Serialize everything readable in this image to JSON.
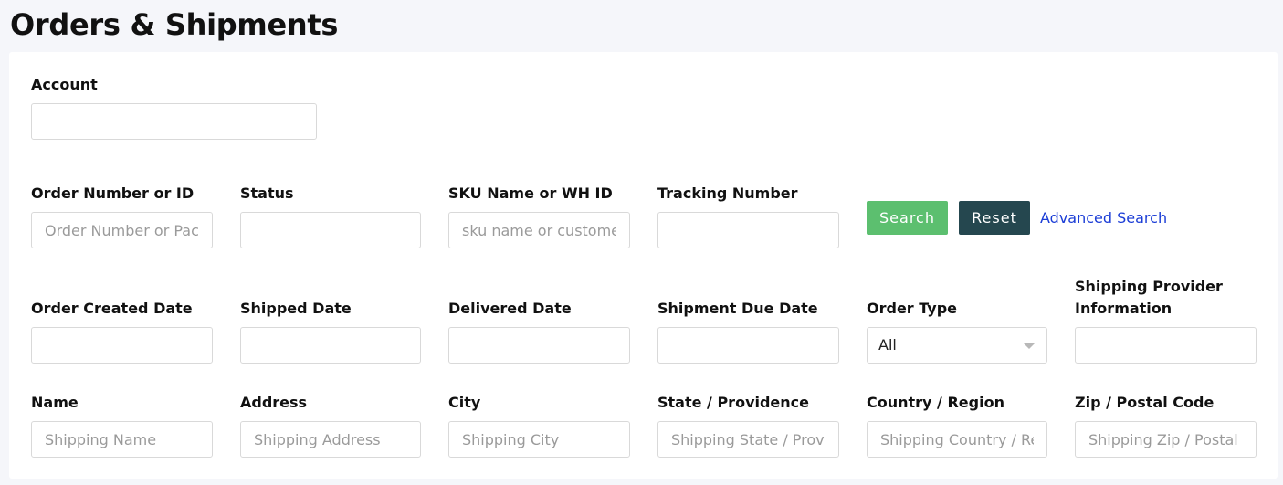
{
  "page": {
    "title": "Orders & Shipments"
  },
  "account": {
    "label": "Account",
    "value": "",
    "placeholder": ""
  },
  "row1": {
    "order_number": {
      "label": "Order Number or ID",
      "placeholder": "Order Number or Package ID"
    },
    "status": {
      "label": "Status",
      "value": ""
    },
    "sku": {
      "label": "SKU Name or WH ID",
      "placeholder": "sku name or customer id"
    },
    "tracking": {
      "label": "Tracking Number",
      "placeholder": ""
    },
    "search_label": "Search",
    "reset_label": "Reset",
    "advanced_label": "Advanced Search"
  },
  "row2": {
    "order_created": {
      "label": "Order Created Date"
    },
    "shipped": {
      "label": "Shipped Date"
    },
    "delivered": {
      "label": "Delivered Date"
    },
    "due": {
      "label": "Shipment Due Date"
    },
    "order_type": {
      "label": "Order Type",
      "value": "All"
    },
    "provider": {
      "label": "Shipping Provider Information"
    }
  },
  "row3": {
    "name": {
      "label": "Name",
      "placeholder": "Shipping Name"
    },
    "address": {
      "label": "Address",
      "placeholder": "Shipping Address"
    },
    "city": {
      "label": "City",
      "placeholder": "Shipping City"
    },
    "state": {
      "label": "State / Providence",
      "placeholder": "Shipping State / Providence"
    },
    "country": {
      "label": "Country / Region",
      "placeholder": "Shipping Country / Region"
    },
    "zip": {
      "label": "Zip / Postal Code",
      "placeholder": "Shipping Zip / Postal Code"
    }
  },
  "colors": {
    "search": "#5cbf6f",
    "reset": "#25474f",
    "link": "#1a3cd6"
  }
}
